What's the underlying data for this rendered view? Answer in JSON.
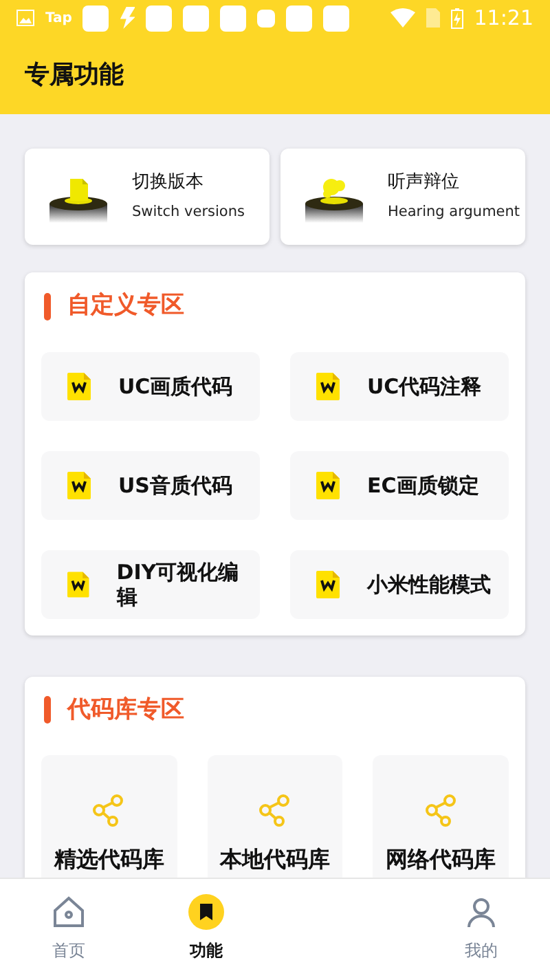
{
  "status_bar": {
    "carrier_label": "Tap",
    "time": "11:21"
  },
  "header": {
    "title": "专属功能"
  },
  "quick_actions": [
    {
      "title": "切换版本",
      "subtitle": "Switch versions",
      "kind": "file"
    },
    {
      "title": "听声辩位",
      "subtitle": "Hearing argument",
      "kind": "ear"
    }
  ],
  "sections": [
    {
      "title": "自定义专区",
      "kind": "grid2",
      "items": [
        {
          "label": "UC画质代码"
        },
        {
          "label": "UC代码注释"
        },
        {
          "label": "US音质代码"
        },
        {
          "label": "EC画质锁定"
        },
        {
          "label": "DIY可视化编辑"
        },
        {
          "label": "小米性能模式"
        }
      ]
    },
    {
      "title": "代码库专区",
      "kind": "grid3",
      "items": [
        {
          "label": "精选代码库"
        },
        {
          "label": "本地代码库"
        },
        {
          "label": "网络代码库"
        }
      ]
    }
  ],
  "bottom_nav": [
    {
      "label": "首页",
      "kind": "home",
      "selected": false
    },
    {
      "label": "功能",
      "kind": "feature",
      "selected": true
    },
    {
      "label": "我的",
      "kind": "me",
      "selected": false
    }
  ]
}
